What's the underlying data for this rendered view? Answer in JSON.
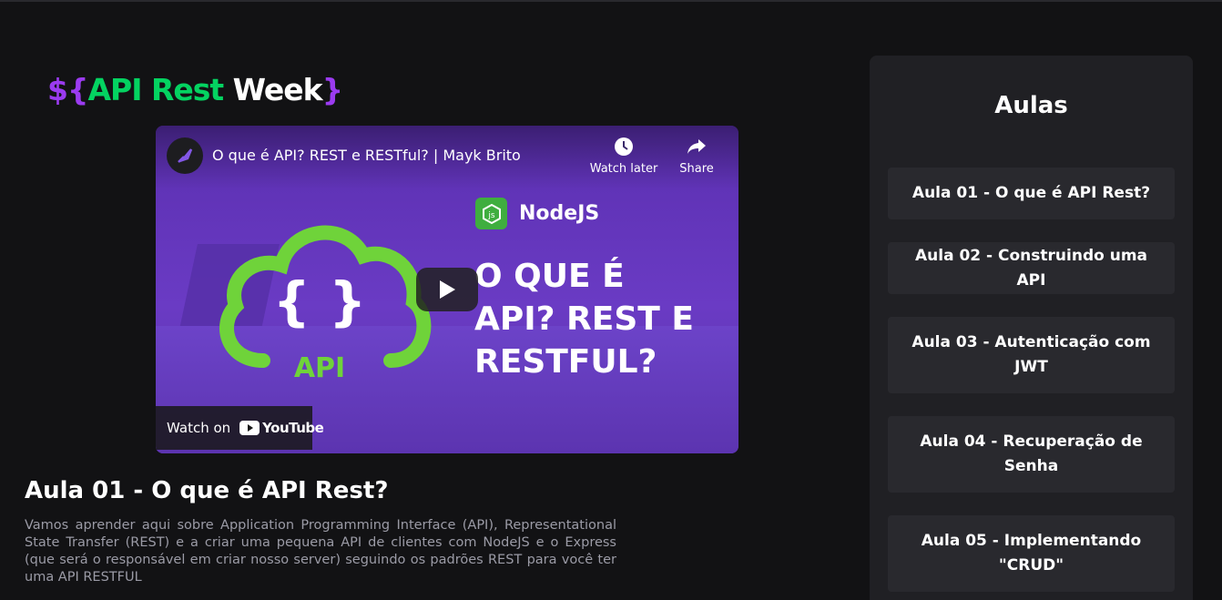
{
  "logo": {
    "open": "${",
    "api_rest": "API Rest",
    "week": "Week",
    "close": "}"
  },
  "video": {
    "title": "O que é API? REST e RESTful? | Mayk Brito",
    "watch_later": "Watch later",
    "share": "Share",
    "thumbnail_badge": "NodeJS",
    "thumbnail_headline": "O QUE É API? REST E RESTFUL?",
    "cloud_braces": "{ }",
    "cloud_label": "API",
    "watch_on": "Watch on",
    "youtube": "YouTube"
  },
  "lesson": {
    "title": "Aula 01 - O que é API Rest?",
    "description": "Vamos aprender aqui sobre Application Programming Interface (API), Representational State Transfer (REST) e a criar uma pequena API de clientes com NodeJS e o Express (que será o responsável em criar nosso server) seguindo os padrões REST para você ter uma API RESTFUL"
  },
  "sidebar": {
    "title": "Aulas",
    "items": [
      {
        "label": "Aula 01 - O que é API Rest?"
      },
      {
        "label": "Aula 02 - Construindo uma API"
      },
      {
        "label": "Aula 03 - Autenticação com JWT"
      },
      {
        "label": "Aula 04 - Recuperação de Senha"
      },
      {
        "label": "Aula 05 - Implementando \"CRUD\""
      }
    ]
  },
  "colors": {
    "background": "#121214",
    "panel": "#202024",
    "item": "#29292e",
    "green": "#04d361",
    "purple": "#9b3bf0"
  }
}
